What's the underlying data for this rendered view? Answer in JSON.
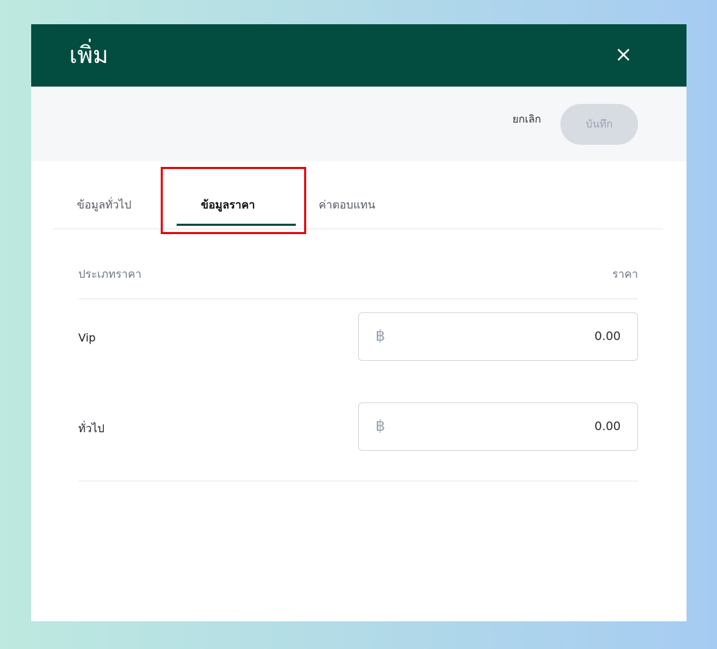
{
  "modal": {
    "title": "เพิ่ม",
    "close_icon": "close-icon"
  },
  "toolbar": {
    "cancel_label": "ยกเลิก",
    "save_label": "บันทึก"
  },
  "tabs": [
    {
      "label": "ข้อมูลทั่วไป",
      "active": false
    },
    {
      "label": "ข้อมูลราคา",
      "active": true
    },
    {
      "label": "ค่าตอบแทน",
      "active": false
    }
  ],
  "price_table": {
    "header_type": "ประเภทราคา",
    "header_price": "ราคา",
    "rows": [
      {
        "label": "Vip",
        "currency": "฿",
        "value": "0.00"
      },
      {
        "label": "ทั่วไป",
        "currency": "฿",
        "value": "0.00"
      }
    ]
  },
  "colors": {
    "header_bg": "#034d40",
    "accent": "#034d40",
    "highlight": "#e8060c"
  }
}
